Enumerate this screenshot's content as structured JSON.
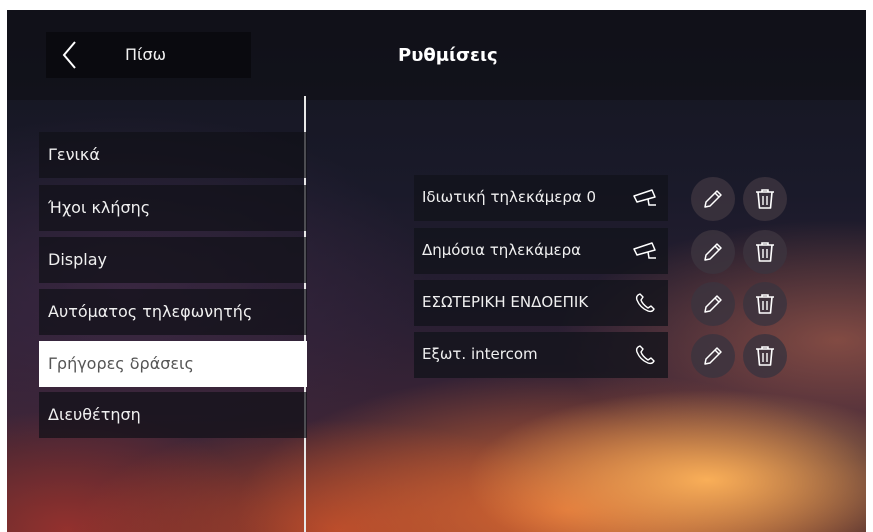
{
  "header": {
    "back_label": "Πίσω",
    "title": "Ρυθμίσεις"
  },
  "menu": {
    "items": [
      {
        "label": "Γενικά",
        "selected": false
      },
      {
        "label": "Ήχοι κλήσης",
        "selected": false
      },
      {
        "label": "Display",
        "selected": false
      },
      {
        "label": "Αυτόματος τηλεφωνητής",
        "selected": false
      },
      {
        "label": "Γρήγορες δράσεις",
        "selected": true
      },
      {
        "label": "Διευθέτηση",
        "selected": false
      }
    ]
  },
  "actions": {
    "items": [
      {
        "label": "Ιδιωτική τηλεκάμερα 0",
        "icon": "camera-icon"
      },
      {
        "label": "Δημόσια τηλεκάμερα",
        "icon": "camera-icon"
      },
      {
        "label": "ΕΣΩΤΕΡΙΚΗ ΕΝΔΟΕΠΙΚ",
        "icon": "phone-icon"
      },
      {
        "label": "Εξωτ. intercom",
        "icon": "phone-icon"
      }
    ],
    "edit_icon": "pencil-icon",
    "delete_icon": "trash-icon"
  },
  "colors": {
    "selected_bg": "#ffffff",
    "selected_text": "#555555",
    "panel_bg": "#101118",
    "round_button_bg": "#3c343e"
  }
}
